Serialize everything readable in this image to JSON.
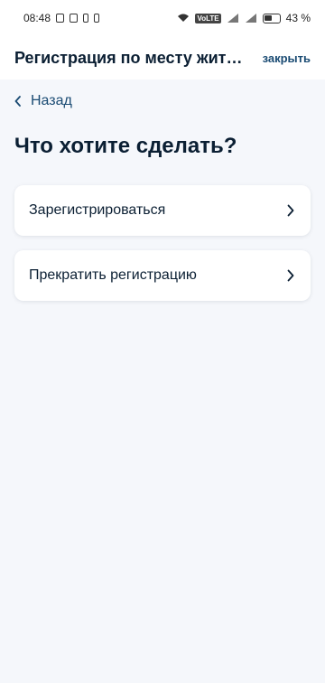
{
  "status_bar": {
    "time": "08:48",
    "battery_percent": "43 %",
    "volte_label": "VoLTE"
  },
  "header": {
    "title": "Регистрация по месту жите...",
    "close_label": "закрыть"
  },
  "back": {
    "label": "Назад"
  },
  "page": {
    "title": "Что хотите сделать?"
  },
  "options": [
    {
      "label": "Зарегистрироваться"
    },
    {
      "label": "Прекратить регистрацию"
    }
  ],
  "colors": {
    "background": "#f5f7fb",
    "text": "#0b1f33",
    "link": "#1a4b73",
    "card": "#ffffff"
  }
}
